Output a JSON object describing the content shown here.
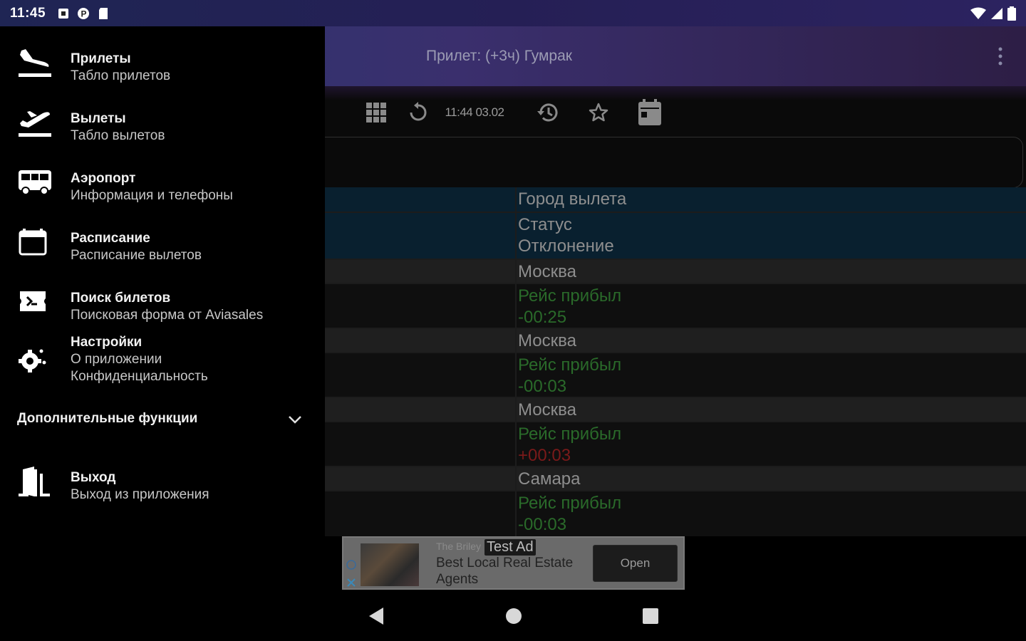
{
  "status_bar": {
    "time": "11:45",
    "left_icons": [
      "notification-square-icon",
      "p-badge-icon",
      "sd-card-icon"
    ],
    "right_icons": [
      "wifi-icon",
      "signal-icon",
      "battery-icon"
    ]
  },
  "app_bar": {
    "title": "Прилет: (+3ч) Гумрак",
    "menu_icon": "more-vert-icon"
  },
  "toolbar": {
    "grid_icon": "grid-icon",
    "refresh_icon": "refresh-icon",
    "updated_time": "11:44 03.02",
    "history_icon": "history-icon",
    "star_icon": "star-outline-icon",
    "calendar_icon": "calendar-icon"
  },
  "table": {
    "header": {
      "city": "Город вылета",
      "status": "Статус",
      "deviation": "Отклонение"
    },
    "rows": [
      {
        "city": "Москва",
        "status": "Рейс прибыл",
        "deviation": "-00:25",
        "deviation_color": "green"
      },
      {
        "city": "Москва",
        "status": "Рейс прибыл",
        "deviation": "-00:03",
        "deviation_color": "green"
      },
      {
        "city": "Москва",
        "status": "Рейс прибыл",
        "deviation": "+00:03",
        "deviation_color": "red"
      },
      {
        "city": "Самара",
        "status": "Рейс прибыл",
        "deviation": "-00:03",
        "deviation_color": "green"
      }
    ]
  },
  "drawer": {
    "items": [
      {
        "title": "Прилеты",
        "subtitles": [
          "Табло прилетов"
        ],
        "icon": "flight-land-icon"
      },
      {
        "title": "Вылеты",
        "subtitles": [
          "Табло вылетов"
        ],
        "icon": "flight-takeoff-icon"
      },
      {
        "title": "Аэропорт",
        "subtitles": [
          "Информация и телефоны"
        ],
        "icon": "bus-icon"
      },
      {
        "title": "Расписание",
        "subtitles": [
          "Расписание вылетов"
        ],
        "icon": "calendar-icon"
      },
      {
        "title": "Поиск билетов",
        "subtitles": [
          "Поисковая форма от Aviasales"
        ],
        "icon": "ticket-search-icon"
      },
      {
        "title": "Настройки",
        "subtitles": [
          "О приложении",
          "Конфиденциальность"
        ],
        "icon": "settings-icon"
      }
    ],
    "section_label": "Дополнительные функции",
    "exit": {
      "title": "Выход",
      "subtitle": "Выход из приложения",
      "icon": "exit-door-icon"
    }
  },
  "ad": {
    "small_text": "The Briley",
    "badge": "Test Ad",
    "headline": "Best Local Real Estate Agents",
    "button": "Open"
  },
  "nav_bar": {
    "back": "back-icon",
    "home": "home-icon",
    "recents": "recents-icon"
  },
  "colors": {
    "status_green": "#2a6a2a",
    "status_red": "#7a1a1a",
    "header_row": "#09202f",
    "app_bar_start": "#2a3770",
    "app_bar_end": "#2d1e45"
  }
}
